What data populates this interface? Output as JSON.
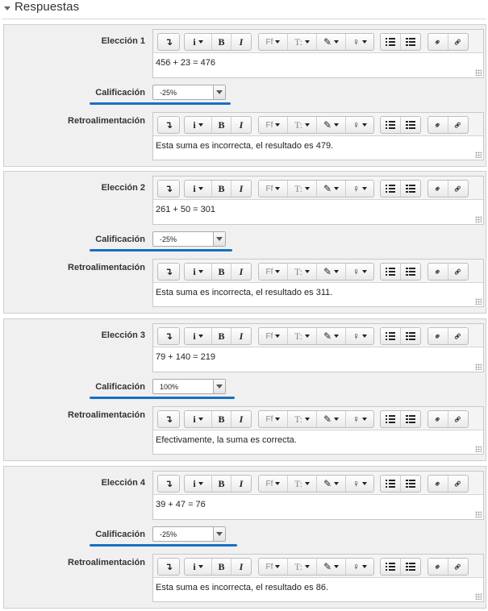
{
  "section": {
    "title": "Respuestas"
  },
  "labels": {
    "grade": "Calificación",
    "feedback": "Retroalimentación"
  },
  "toolbar": {
    "undo": "↴",
    "info": "i",
    "bold": "B",
    "italic": "I",
    "font": "Ff",
    "text_style": "T:",
    "brush": "✎",
    "bulb": "♀",
    "link": "⚭",
    "unlink": "⚮"
  },
  "choices": [
    {
      "label": "Elección 1",
      "answer": "456 + 23 = 476",
      "grade": "-25%",
      "feedback": "Esta suma es incorrecta, el resultado es 479."
    },
    {
      "label": "Elección 2",
      "answer": "261 + 50 = 301",
      "grade": "-25%",
      "feedback": "Esta suma es incorrecta, el resultado es 311."
    },
    {
      "label": "Elección 3",
      "answer": "79 + 140 = 219",
      "grade": "100%",
      "feedback": "Efectivamente, la suma es correcta."
    },
    {
      "label": "Elección 4",
      "answer": "39 + 47 = 76",
      "grade": "-25%",
      "feedback": "Esta suma es incorrecta, el resultado es 86."
    }
  ],
  "colors": {
    "underline": "#1670c2",
    "panel": "#f0f0f0"
  },
  "icons": [
    "collapse-caret-icon",
    "undo-icon",
    "info-icon",
    "bold-icon",
    "italic-icon",
    "font-icon",
    "text-style-icon",
    "brush-icon",
    "bulb-icon",
    "bullet-list-icon",
    "numbered-list-icon",
    "link-icon",
    "unlink-icon",
    "resize-grip-icon"
  ]
}
